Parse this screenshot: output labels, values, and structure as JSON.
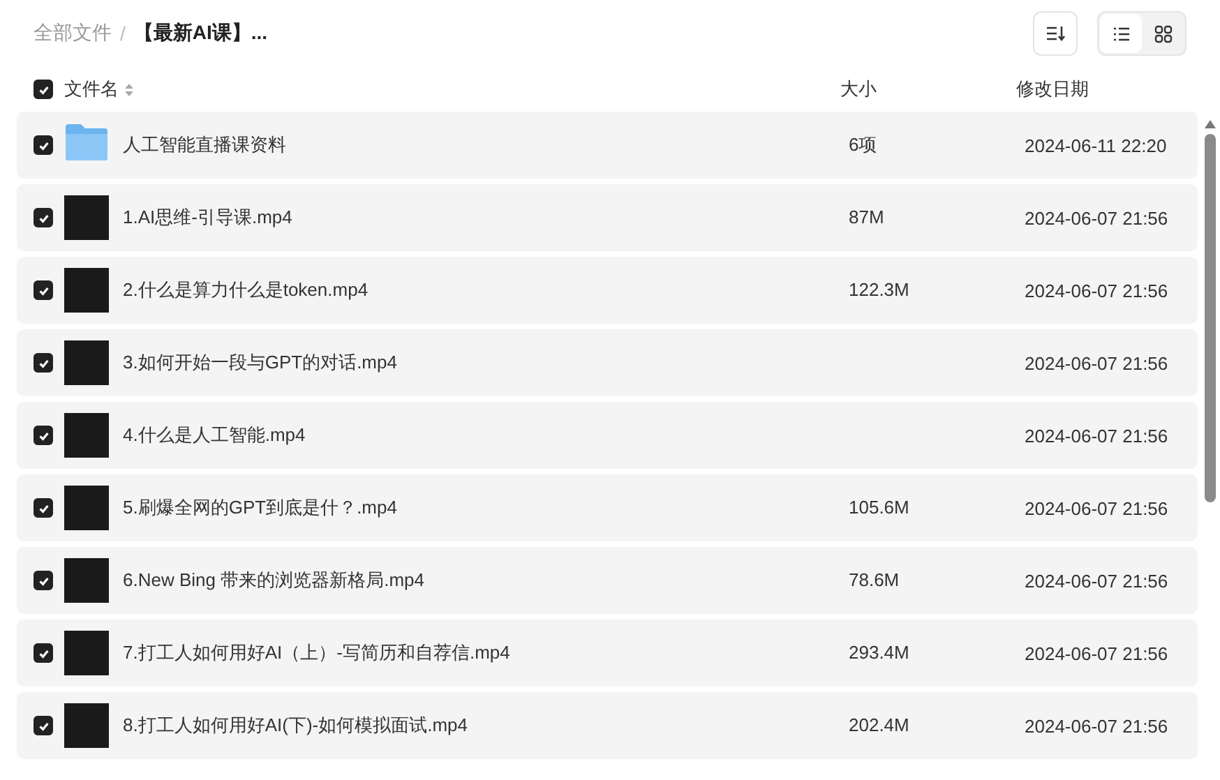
{
  "breadcrumb": [
    {
      "label": "全部文件",
      "current": false
    },
    {
      "label": "【最新AI课】...",
      "current": true
    }
  ],
  "breadcrumb_separator": "/",
  "toolbar": {
    "sort_button": true,
    "view_modes": [
      {
        "kind": "list",
        "selected": true
      },
      {
        "kind": "grid",
        "selected": false
      }
    ]
  },
  "table": {
    "all_checked": true,
    "columns": [
      {
        "label": "文件名",
        "sortable": true
      },
      {
        "label": "大小",
        "sortable": false
      },
      {
        "label": "修改日期",
        "sortable": false
      }
    ],
    "rows": [
      {
        "kind": "folder",
        "name": "人工智能直播课资料",
        "size": "6项",
        "date": "2024-06-11 22:20",
        "checked": true
      },
      {
        "kind": "video",
        "name": "1.AI思维-引导课.mp4",
        "size": "87M",
        "date": "2024-06-07 21:56",
        "checked": true
      },
      {
        "kind": "video",
        "name": "2.什么是算力什么是token.mp4",
        "size": "122.3M",
        "date": "2024-06-07 21:56",
        "checked": true
      },
      {
        "kind": "video",
        "name": "3.如何开始一段与GPT的对话.mp4",
        "date": "2024-06-07 21:56",
        "checked": true
      },
      {
        "kind": "video",
        "name": "4.什么是人工智能.mp4",
        "date": "2024-06-07 21:56",
        "checked": true
      },
      {
        "kind": "video",
        "name": "5.刷爆全网的GPT到底是什？.mp4",
        "size": "105.6M",
        "date": "2024-06-07 21:56",
        "checked": true
      },
      {
        "kind": "video",
        "name": "6.New Bing 带来的浏览器新格局.mp4",
        "size": "78.6M",
        "date": "2024-06-07 21:56",
        "checked": true
      },
      {
        "kind": "video",
        "name": "7.打工人如何用好AI（上）-写简历和自荐信.mp4",
        "size": "293.4M",
        "date": "2024-06-07 21:56",
        "checked": true
      },
      {
        "kind": "video",
        "name": "8.打工人如何用好AI(下)-如何模拟面试.mp4",
        "size": "202.4M",
        "date": "2024-06-07 21:56",
        "checked": true
      }
    ]
  }
}
